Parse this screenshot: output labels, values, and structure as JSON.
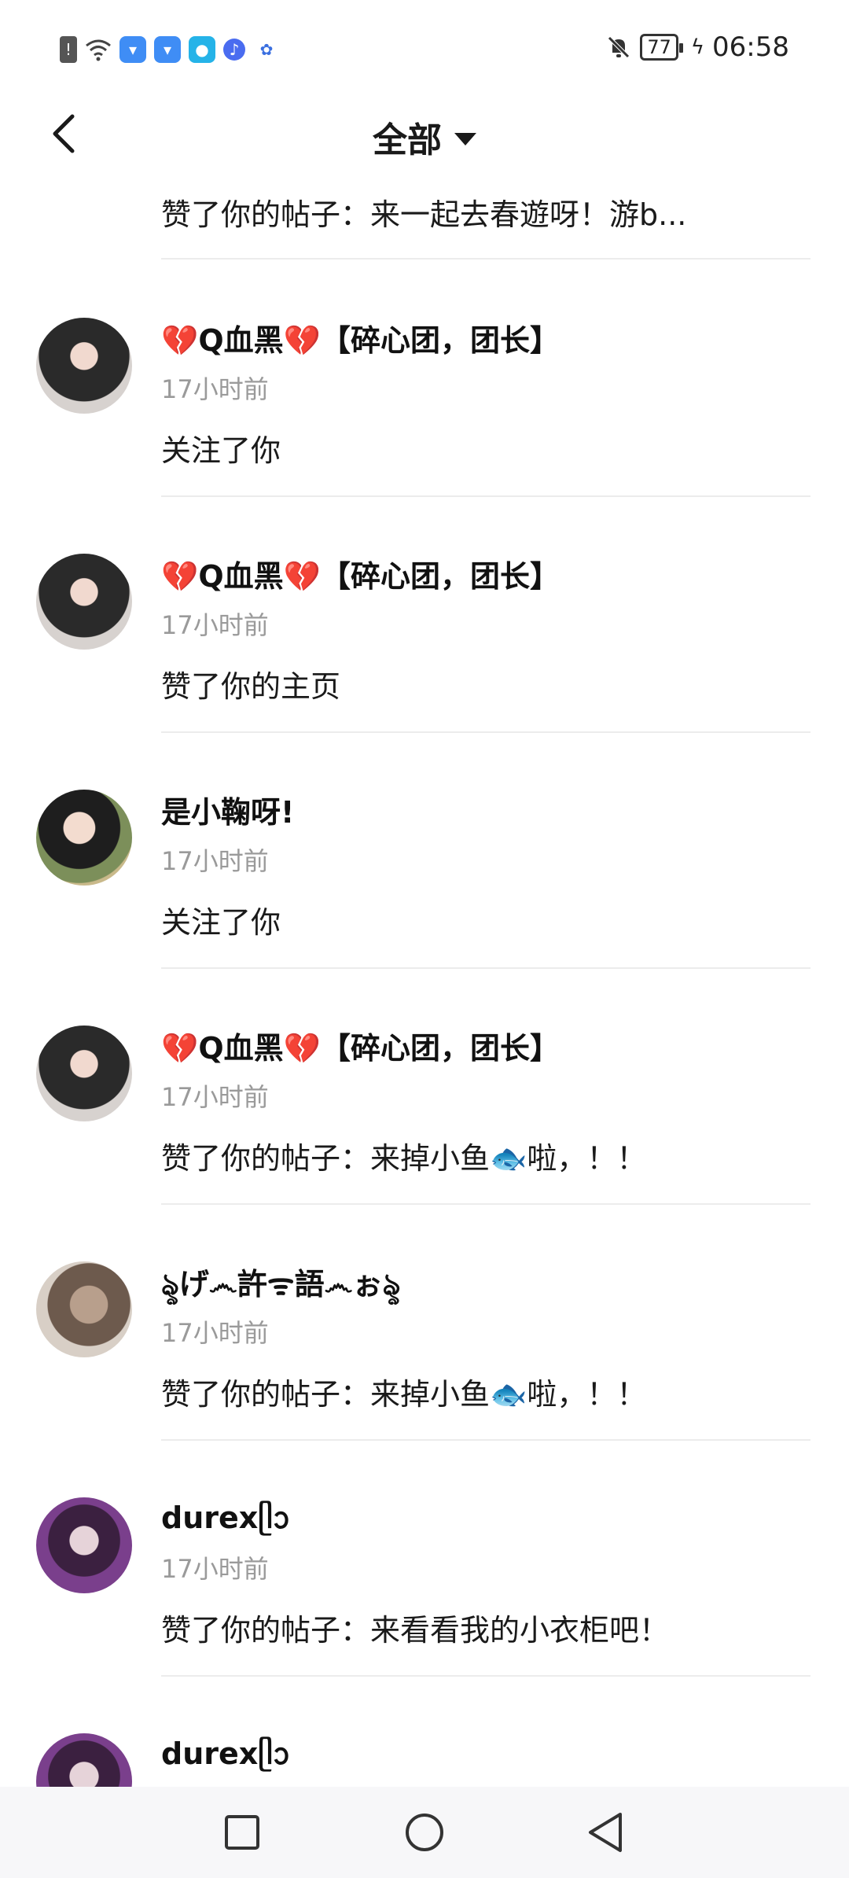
{
  "status_bar": {
    "time": "06:58",
    "battery": "77",
    "icons": [
      "alert-icon",
      "wifi-icon",
      "taobao-icon",
      "taobao-icon",
      "weather-icon",
      "music-icon",
      "baidu-icon"
    ]
  },
  "nav": {
    "title": "全部"
  },
  "partial_item": {
    "action": "赞了你的帖子：来一起去春遊呀！游b..."
  },
  "items": [
    {
      "name_heart_left": "💔",
      "name_main": "Q血黑",
      "name_heart_right": "💔",
      "name_suffix": "【碎心团，团长】",
      "time": "17小时前",
      "action": "关注了你",
      "avatar": "avatar-1"
    },
    {
      "name_heart_left": "💔",
      "name_main": "Q血黑",
      "name_heart_right": "💔",
      "name_suffix": "【碎心团，团长】",
      "time": "17小时前",
      "action": "赞了你的主页",
      "avatar": "avatar-1"
    },
    {
      "name_heart_left": "",
      "name_main": "是小鞠呀!",
      "name_heart_right": "",
      "name_suffix": "",
      "time": "17小时前",
      "action": "关注了你",
      "avatar": "avatar-2"
    },
    {
      "name_heart_left": "💔",
      "name_main": "Q血黑",
      "name_heart_right": "💔",
      "name_suffix": "【碎心团，团长】",
      "time": "17小时前",
      "action": "赞了你的帖子：来掉小鱼🐟啦，！！",
      "avatar": "avatar-1"
    },
    {
      "name_heart_left": "",
      "name_main": "ৡげ෴許ᯤ語෴ぉৡ",
      "name_heart_right": "",
      "name_suffix": "",
      "time": "17小时前",
      "action": "赞了你的帖子：来掉小鱼🐟啦，！！",
      "avatar": "avatar-3"
    },
    {
      "name_heart_left": "",
      "name_main": "durexᥫᩣ",
      "name_heart_right": "",
      "name_suffix": "",
      "time": "17小时前",
      "action": "赞了你的帖子：来看看我的小衣柜吧！",
      "avatar": "avatar-4"
    },
    {
      "name_heart_left": "",
      "name_main": "durexᥫᩣ",
      "name_heart_right": "",
      "name_suffix": "",
      "time": "",
      "action": "",
      "avatar": "avatar-4"
    }
  ]
}
